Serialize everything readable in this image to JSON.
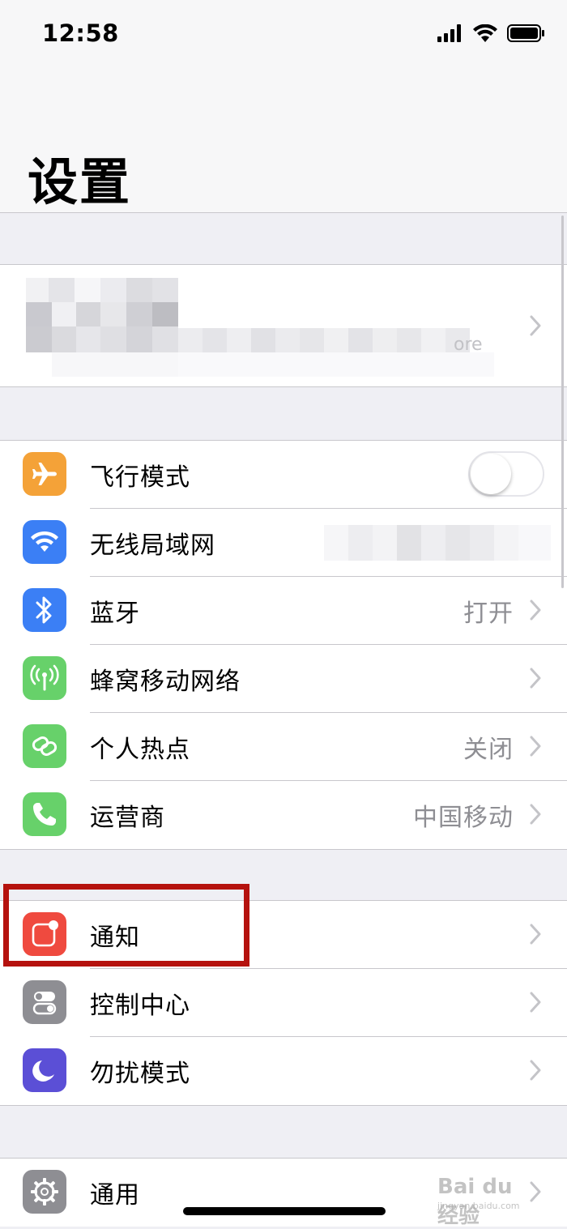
{
  "status_bar": {
    "time": "12:58"
  },
  "nav": {
    "title": "设置"
  },
  "profile": {
    "fragment": "ore"
  },
  "group1": [
    {
      "key": "airplane",
      "label": "飞行模式",
      "icon": "airplane-icon",
      "icon_color": "#f4a238",
      "toggle_on": false
    },
    {
      "key": "wifi",
      "label": "无线局域网",
      "icon": "wifi-icon",
      "icon_color": "#3b7ff5"
    },
    {
      "key": "bluetooth",
      "label": "蓝牙",
      "value": "打开",
      "icon": "bluetooth-icon",
      "icon_color": "#3b7ff5"
    },
    {
      "key": "cellular",
      "label": "蜂窝移动网络",
      "icon": "cellular-icon",
      "icon_color": "#67d16a"
    },
    {
      "key": "hotspot",
      "label": "个人热点",
      "value": "关闭",
      "icon": "hotspot-icon",
      "icon_color": "#67d16a"
    },
    {
      "key": "carrier",
      "label": "运营商",
      "value": "中国移动",
      "icon": "phone-icon",
      "icon_color": "#67d16a"
    }
  ],
  "group2": [
    {
      "key": "notifications",
      "label": "通知",
      "icon": "notifications-icon",
      "icon_color": "#ef4a3f"
    },
    {
      "key": "control_center",
      "label": "控制中心",
      "icon": "switches-icon",
      "icon_color": "#8e8e93"
    },
    {
      "key": "dnd",
      "label": "勿扰模式",
      "icon": "moon-icon",
      "icon_color": "#5b4fd6"
    }
  ],
  "group3": [
    {
      "key": "general",
      "label": "通用",
      "icon": "gear-icon",
      "icon_color": "#8e8e93"
    }
  ],
  "watermark": {
    "text": "Bai du 经验",
    "sub": "jingyan.baidu.com"
  }
}
